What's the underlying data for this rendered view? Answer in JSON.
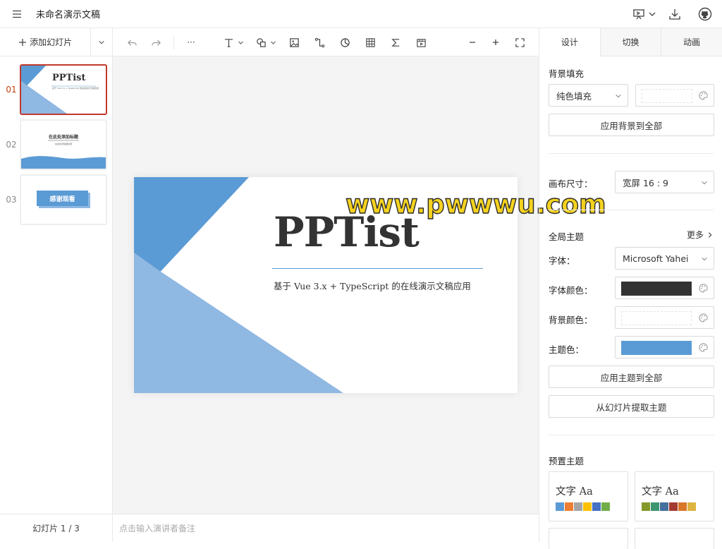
{
  "app": {
    "doc_title": "未命名演示文稿",
    "icons": [
      "menu-icon",
      "present-icon",
      "download-icon",
      "github-icon"
    ]
  },
  "left": {
    "add_slide": "添加幻灯片",
    "thumbs": [
      {
        "num": "01",
        "title": "PPTist",
        "sub": "基于 Vue 3.x + TypeScript 的在线演示文稿应用"
      },
      {
        "num": "02",
        "title": "在此处添加标题",
        "sub": "在此处添加副标题"
      },
      {
        "num": "03",
        "title": "感谢观看"
      }
    ],
    "footer": "幻灯片 1 / 3"
  },
  "toolbar": {
    "items": [
      "undo-icon",
      "redo-icon",
      "more-icon",
      "text-icon",
      "shape-icon",
      "image-icon",
      "line-icon",
      "chart-icon",
      "table-icon",
      "formula-icon",
      "media-icon",
      "zoom-out-icon",
      "zoom-in-icon",
      "fullscreen-icon"
    ],
    "more": "···"
  },
  "slide": {
    "title": "PPTist",
    "subtitle": "基于 Vue 3.x + TypeScript 的在线演示文稿应用",
    "watermark": "www.pwwwu.com",
    "accent": "#5b9bd5",
    "accent_light": "#8fb8e2"
  },
  "notes": {
    "placeholder": "点击输入演讲者备注"
  },
  "panel": {
    "tabs": [
      "设计",
      "切换",
      "动画"
    ],
    "bg_fill": {
      "title": "背景填充",
      "type": "纯色填充",
      "apply_all": "应用背景到全部"
    },
    "canvas": {
      "label": "画布尺寸：",
      "value": "宽屏 16 : 9"
    },
    "theme": {
      "title": "全局主题",
      "more": "更多",
      "font_label": "字体：",
      "font_value": "Microsoft Yahei",
      "font_color_label": "字体颜色：",
      "font_color": "#333333",
      "bg_color_label": "背景颜色：",
      "bg_color": "#ffffff",
      "theme_color_label": "主题色：",
      "theme_color": "#5b9bd5",
      "apply_all": "应用主题到全部",
      "extract": "从幻灯片提取主题"
    },
    "presets": {
      "title": "预置主题",
      "card_text": "文字 Aa",
      "cards": [
        {
          "colors": [
            "#5b9bd5",
            "#ed7d31",
            "#a5a5a5",
            "#ffc000",
            "#4472c4",
            "#70ad47"
          ]
        },
        {
          "colors": [
            "#83992a",
            "#3c9670",
            "#44709d",
            "#a23b32",
            "#d87728",
            "#deb340"
          ]
        }
      ]
    }
  }
}
